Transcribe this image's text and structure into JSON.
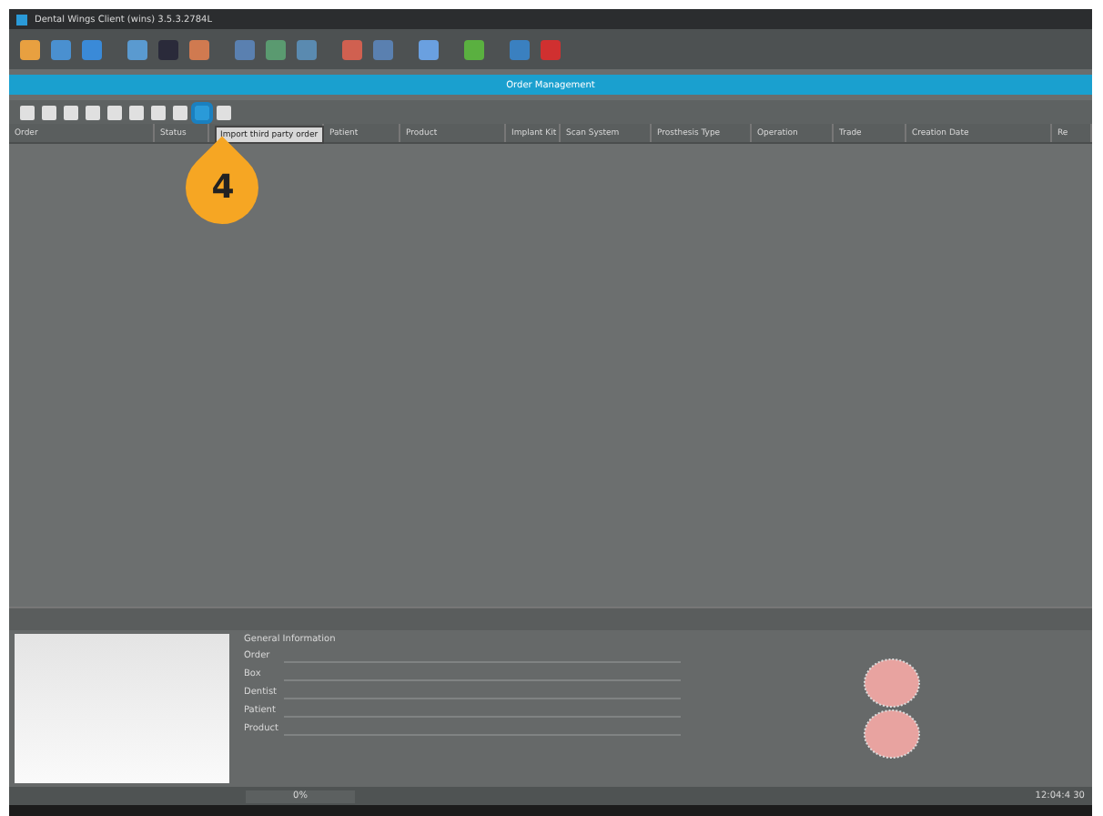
{
  "window": {
    "title": "Dental Wings Client (wins)  3.5.3.2784L"
  },
  "toolbar": {
    "buttons": [
      {
        "color": "#e8a040"
      },
      {
        "color": "#4a90d0"
      },
      {
        "color": "#3a8ad8"
      },
      {
        "color": "#5a9ad0"
      },
      {
        "color": "#2a2a3a"
      },
      {
        "color": "#d07a50"
      },
      {
        "color": "#5a80b0"
      },
      {
        "color": "#5a9a70"
      },
      {
        "color": "#5a8ab0"
      },
      {
        "color": "#d06050"
      },
      {
        "color": "#5a80b0"
      },
      {
        "color": "#6aa0e0"
      },
      {
        "color": "#5ab040"
      },
      {
        "color": "#3a80c0"
      },
      {
        "color": "#d03030"
      }
    ]
  },
  "header": {
    "title": "Order Management"
  },
  "order_toolbar": {
    "buttons": [
      {
        "selected": false
      },
      {
        "selected": false
      },
      {
        "selected": false
      },
      {
        "selected": false
      },
      {
        "selected": false
      },
      {
        "selected": false
      },
      {
        "selected": false
      },
      {
        "selected": false
      },
      {
        "selected": true
      },
      {
        "selected": false
      }
    ]
  },
  "tooltip": "Import third party order",
  "table": {
    "columns": [
      "Order",
      "Status",
      "",
      "Patient",
      "Product",
      "Implant Kit",
      "Scan System",
      "Prosthesis Type",
      "Operation",
      "Trade",
      "Creation Date",
      "Re"
    ]
  },
  "callout": "4",
  "details": {
    "title": "General Information",
    "fields": [
      "Order",
      "Box",
      "Dentist",
      "Patient",
      "Product"
    ]
  },
  "status_bar": {
    "progress": "0%",
    "clock": "12:04:4 30"
  }
}
